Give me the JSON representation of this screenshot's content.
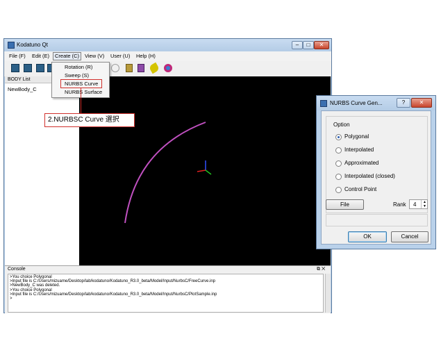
{
  "main_window": {
    "title": "Kodatuno Qt",
    "controls": {
      "minimize": "–",
      "maximize": "□",
      "close": "✕"
    }
  },
  "menubar": {
    "items": [
      {
        "label": "File (F)"
      },
      {
        "label": "Edit (E)"
      },
      {
        "label": "Create (C)"
      },
      {
        "label": "View (V)"
      },
      {
        "label": "User (U)"
      },
      {
        "label": "Help (H)"
      }
    ]
  },
  "create_menu": {
    "items": [
      {
        "label": "Rotation (R)"
      },
      {
        "label": "Sweep (S)"
      },
      {
        "label": "NURBS Curve"
      },
      {
        "label": "NURBS Surface"
      }
    ]
  },
  "body_list": {
    "header": "BODY List",
    "items": [
      "NewBody_C"
    ]
  },
  "console": {
    "header": "Console",
    "controls": "⧉ ✕",
    "lines": [
      ">You choice Polygonal",
      ">Input file is C:/Users/mizuame/Desktop/lab/kodatuno/Kodatuno_R3.0_beta/Model/Input/NurbsC/FreeCurve.inp",
      ">NewBody_C was deleted.",
      ">You choice Polygonal",
      ">Input file is C:/Users/mizuame/Desktop/lab/kodatuno/Kodatuno_R3.0_beta/Model/Input/NurbsC/PlotSample.inp",
      ">"
    ]
  },
  "callout": {
    "text": "2.NURBSC Curve 選択"
  },
  "dialog": {
    "title": "NURBS Curve Gen...",
    "controls": {
      "help": "?",
      "close": "✕"
    },
    "option_group_label": "Option",
    "options": [
      {
        "label": "Polygonal",
        "checked": true
      },
      {
        "label": "Interpolated",
        "checked": false
      },
      {
        "label": "Approximated",
        "checked": false
      },
      {
        "label": "Interpolated (closed)",
        "checked": false
      },
      {
        "label": "Control Point",
        "checked": false
      }
    ],
    "file_button": "File",
    "rank_label": "Rank",
    "rank_value": "4",
    "ok_button": "OK",
    "cancel_button": "Cancel"
  },
  "colors": {
    "curve": "#c050c0",
    "axis_x": "#e02020",
    "axis_y": "#20c020",
    "axis_z": "#3050ff",
    "highlight": "#d0302c"
  }
}
